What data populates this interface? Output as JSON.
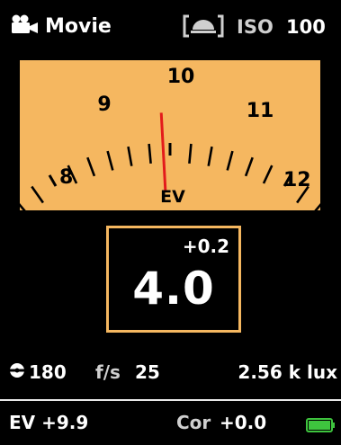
{
  "header": {
    "mode_label": "Movie",
    "mode_icon": "movie-camera-icon",
    "metering_icon": "incident-dome-icon",
    "iso_label": "ISO",
    "iso_value": "100"
  },
  "gauge": {
    "scale_labels": [
      "8",
      "9",
      "10",
      "11",
      "12"
    ],
    "unit_label": "EV",
    "needle_value": 9.9,
    "range": [
      8,
      12
    ],
    "colors": {
      "face": "#f5b760",
      "needle": "#e31b1b",
      "ink": "#000000"
    }
  },
  "reading": {
    "offset": "+0.2",
    "value": "4.0",
    "border_color": "#f5b760"
  },
  "info": {
    "shutter_icon": "shutter-angle-icon",
    "shutter_value": "180",
    "fps_label": "f/s",
    "fps_value": "25",
    "lux": "2.56 k lux"
  },
  "footer": {
    "ev_readout": "EV +9.9",
    "cor_label": "Cor",
    "cor_value": "+0.0",
    "battery_icon": "battery-icon",
    "battery_level": 1.0,
    "battery_color": "#3ec43e"
  }
}
